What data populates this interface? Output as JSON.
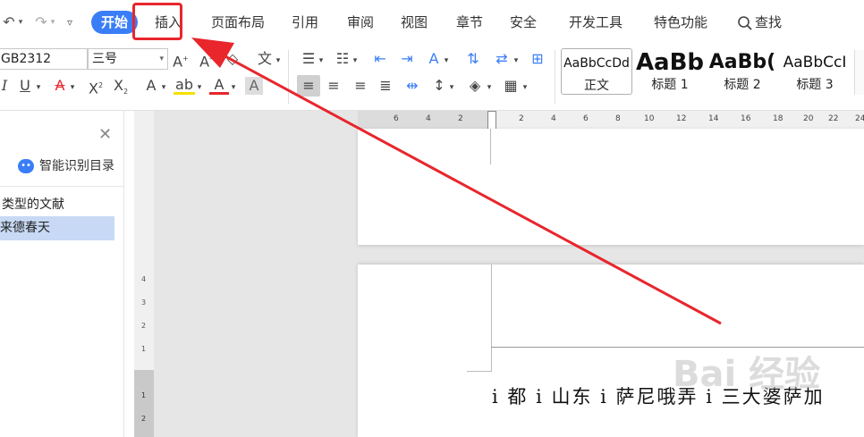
{
  "menu": {
    "start": "开始",
    "insert": "插入",
    "layout": "页面布局",
    "references": "引用",
    "review": "审阅",
    "view": "视图",
    "sections": "章节",
    "security": "安全",
    "devtools": "开发工具",
    "features": "特色功能",
    "search": "查找"
  },
  "toolbar": {
    "font_name": "GB2312",
    "font_size": "三号",
    "styles": [
      {
        "sample": "AaBbCcDd",
        "name": "正文"
      },
      {
        "sample": "AaBb",
        "name": "标题 1"
      },
      {
        "sample": "AaBb(",
        "name": "标题 2"
      },
      {
        "sample": "AaBbCcI",
        "name": "标题 3"
      }
    ]
  },
  "nav_panel": {
    "smart_toc": "智能识别目录",
    "items": [
      "类型的文献",
      "来德春天"
    ]
  },
  "ruler": {
    "top_ticks": [
      "6",
      "4",
      "2",
      "2",
      "4",
      "6",
      "8",
      "10",
      "12",
      "14",
      "16",
      "18",
      "20",
      "22",
      "24"
    ],
    "left_ticks": [
      "4",
      "3",
      "2",
      "1",
      "1",
      "2"
    ]
  },
  "document": {
    "body_text": "i 都 i 山东 i 萨尼哦弄 i 三大婆萨加"
  },
  "watermark": "Bai 经验",
  "colors": {
    "accent": "#3a7ef7",
    "highlight_box": "#e8262c",
    "arrow": "#e8262c",
    "selected_item": "#c7d9f4"
  }
}
